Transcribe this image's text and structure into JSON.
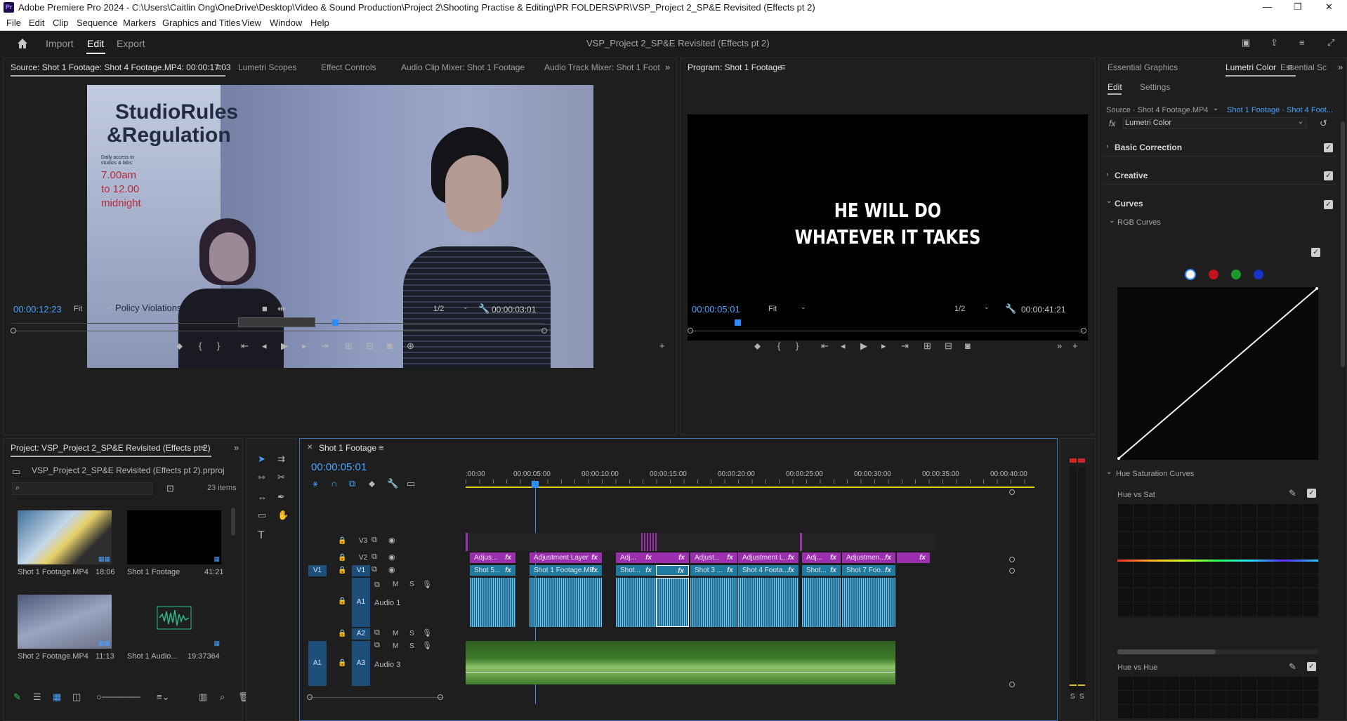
{
  "window": {
    "title": "Adobe Premiere Pro 2024 - C:\\Users\\Caitlin Ong\\OneDrive\\Desktop\\Video & Sound Production\\Project 2\\Shooting Practise & Editing\\PR FOLDERS\\PR\\VSP_Project 2_SP&E Revisited (Effects pt 2)",
    "app_icon": "Pr",
    "controls": [
      "—",
      "❐",
      "✕"
    ]
  },
  "menu": [
    "File",
    "Edit",
    "Clip",
    "Sequence",
    "Markers",
    "Graphics and Titles",
    "View",
    "Window",
    "Help"
  ],
  "header": {
    "workspaces": [
      "Import",
      "Edit",
      "Export"
    ],
    "active_workspace": "Edit",
    "project_title": "VSP_Project 2_SP&E Revisited (Effects pt 2)"
  },
  "source_panel": {
    "tabs": [
      "Source: Shot 1 Footage: Shot 4 Footage.MP4: 00:00:17:03",
      "Lumetri Scopes",
      "Effect Controls",
      "Audio Clip Mixer: Shot 1 Footage",
      "Audio Track Mixer: Shot 1 Foot"
    ],
    "timecode": "00:00:12:23",
    "fit": "Fit",
    "resolution": "1/2",
    "duration": "00:00:03:01",
    "poster_title_line1": "StudioRules",
    "poster_title_line2": "&Regulation",
    "poster_lines": [
      "Daily access to",
      "studios & labs:",
      "7.00am",
      "to 12.00",
      "midnight"
    ],
    "poster_footer": "Policy Violations"
  },
  "program_panel": {
    "tab": "Program: Shot 1 Footage",
    "caption_line1": "HE WILL DO",
    "caption_line2": "WHATEVER IT TAKES",
    "timecode": "00:00:05:01",
    "fit": "Fit",
    "resolution": "1/2",
    "duration": "00:00:41:21"
  },
  "project_panel": {
    "tab": "Project: VSP_Project 2_SP&E Revisited (Effects pt 2)",
    "file": "VSP_Project 2_SP&E Revisited (Effects pt 2).prproj",
    "item_count": "23 items",
    "items": [
      {
        "name": "Shot 1 Footage.MP4",
        "dur": "18:06"
      },
      {
        "name": "Shot 1 Footage",
        "dur": "41:21"
      },
      {
        "name": "Shot 2 Footage.MP4",
        "dur": "11:13"
      },
      {
        "name": "Shot 1 Audio...",
        "dur": "19:37364"
      }
    ]
  },
  "timeline": {
    "tab": "Shot 1 Footage",
    "timecode": "00:00:05:01",
    "ruler": [
      ":00:00",
      "00:00:05:00",
      "00:00:10:00",
      "00:00:15:00",
      "00:00:20:00",
      "00:00:25:00",
      "00:00:30:00",
      "00:00:35:00",
      "00:00:40:00"
    ],
    "tracks": {
      "v3": "V3",
      "v2": "V2",
      "v1": "V1",
      "v1_src": "V1",
      "a1": "A1",
      "a1_name": "Audio 1",
      "a2": "A2",
      "a3": "A3",
      "a3_src": "A1",
      "a3_name": "Audio 3"
    },
    "track_buttons": {
      "m": "M",
      "s": "S"
    },
    "v2_clips": [
      {
        "label": "Adjus...",
        "fx": "fx"
      },
      {
        "label": "Adjustment Layer",
        "fx": "fx"
      },
      {
        "label": "Adj...",
        "fx": "fx"
      },
      {
        "label": "",
        "fx": "fx"
      },
      {
        "label": "Adjust...",
        "fx": "fx"
      },
      {
        "label": "Adjustment L...",
        "fx": "fx"
      },
      {
        "label": "Adj...",
        "fx": "fx"
      },
      {
        "label": "Adjustmen...",
        "fx": "fx"
      },
      {
        "label": "",
        "fx": "fx"
      }
    ],
    "v1_clips": [
      {
        "label": "Shot 5...",
        "fx": "fx"
      },
      {
        "label": "Shot 1 Footage.MP...",
        "fx": "fx"
      },
      {
        "label": "Shot...",
        "fx": "fx"
      },
      {
        "label": "",
        "fx": "fx"
      },
      {
        "label": "Shot 3 ...",
        "fx": "fx"
      },
      {
        "label": "Shot 4 Foota...",
        "fx": "fx"
      },
      {
        "label": "Shot...",
        "fx": "fx"
      },
      {
        "label": "Shot 7 Foo...",
        "fx": "fx"
      }
    ],
    "meter_labels": [
      "S",
      "S"
    ]
  },
  "lumetri": {
    "tabs": [
      "Essential Graphics",
      "Lumetri Color",
      "Essential Sc"
    ],
    "subtabs": [
      "Edit",
      "Settings"
    ],
    "source": "Source · Shot 4 Footage.MP4",
    "target": "Shot 1 Footage · Shot 4 Foot...",
    "fx_label": "fx",
    "effect": "Lumetri Color",
    "sections": [
      "Basic Correction",
      "Creative",
      "Curves"
    ],
    "rgb_curves": "RGB Curves",
    "hue_sat_curves": "Hue Saturation Curves",
    "hue_vs_sat": "Hue vs Sat",
    "hue_vs_hue": "Hue vs Hue",
    "channel_colors": [
      "#ffffff",
      "#c0141e",
      "#1d9a2e",
      "#1733c8"
    ]
  },
  "colors": {
    "accent_blue": "#4aa3ff",
    "video_clip": "#1f7ba0",
    "adjustment_clip": "#9b2fae",
    "audio3_clip": "#3d7a2a"
  }
}
